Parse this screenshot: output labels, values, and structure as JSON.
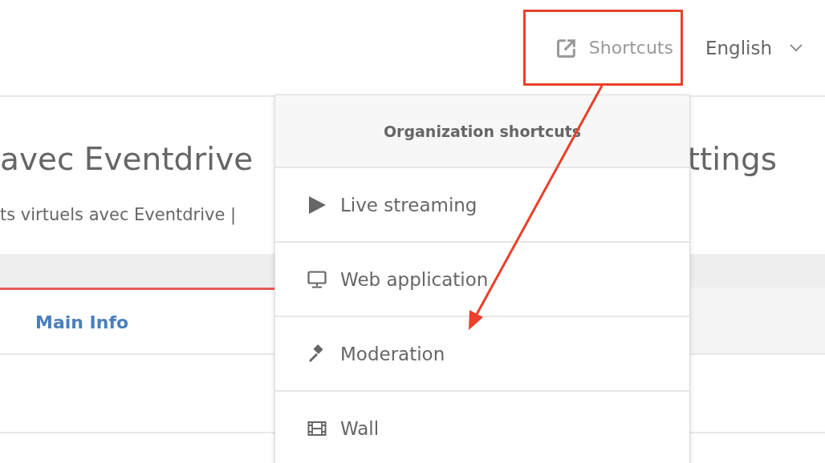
{
  "header": {
    "shortcuts": "Shortcuts",
    "language": "English"
  },
  "page": {
    "title_left": "avec Eventdrive",
    "title_right": "ttings",
    "subtitle": "ts virtuels avec Eventdrive |"
  },
  "tabs": [
    {
      "label": "Main Info",
      "selected": true
    }
  ],
  "menu": {
    "title": "Organization shortcuts",
    "items": [
      {
        "label": "Live streaming",
        "kind": "play"
      },
      {
        "label": "Web application",
        "kind": "monitor"
      },
      {
        "label": "Moderation",
        "kind": "gavel"
      },
      {
        "label": "Wall",
        "kind": "film"
      }
    ]
  }
}
